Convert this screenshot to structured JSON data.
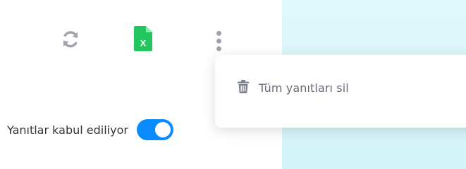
{
  "toolbar": {
    "refresh_icon": "refresh-icon",
    "excel_icon": "excel-file-icon",
    "more_icon": "more-vertical-icon",
    "excel_badge": "X"
  },
  "menu": {
    "items": [
      {
        "label": "Tüm yanıtları sil",
        "icon": "trash-icon"
      }
    ]
  },
  "responses": {
    "label": "Yanıtlar kabul ediliyor",
    "enabled": true
  },
  "colors": {
    "accent": "#0a8cff",
    "excel": "#22c55e",
    "icon_gray": "#9ea4ad",
    "panel_bg": "#dff8fb"
  }
}
